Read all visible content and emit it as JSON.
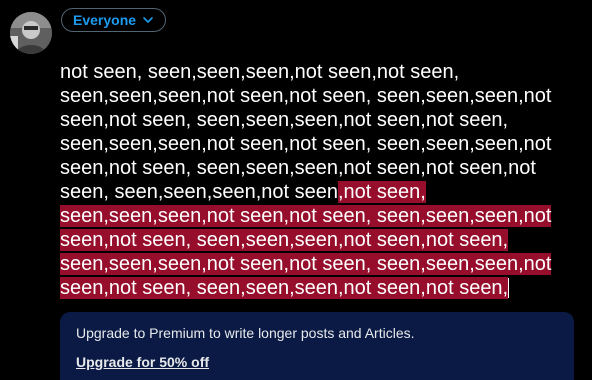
{
  "composer": {
    "audience_label": "Everyone",
    "audience_icon": "chevron-down-icon",
    "text_within_limit": "not seen, seen,seen,seen,not seen,not seen, seen,seen,seen,not seen,not seen, seen,seen,seen,not seen,not seen, seen,seen,seen,not seen,not seen, seen,seen,seen,not seen,not seen, seen,seen,seen,not seen,not seen, seen,seen,seen,not seen,not seen,not seen, seen,seen,seen,not seen",
    "text_over_limit": ",not seen, seen,seen,seen,not seen,not seen, seen,seen,seen,not seen,not seen, seen,seen,seen,not seen,not seen, seen,seen,seen,not seen,not seen, seen,seen,seen,not seen,not seen, seen,seen,seen,not seen,not seen,"
  },
  "premium_notice": {
    "message": "Upgrade to Premium to write longer posts and Articles.",
    "link_label": "Upgrade for 50% off"
  },
  "colors": {
    "background": "#000000",
    "accent": "#1d9bf0",
    "overflow_highlight": "#960e2b",
    "premium_card": "#0a1a45"
  }
}
